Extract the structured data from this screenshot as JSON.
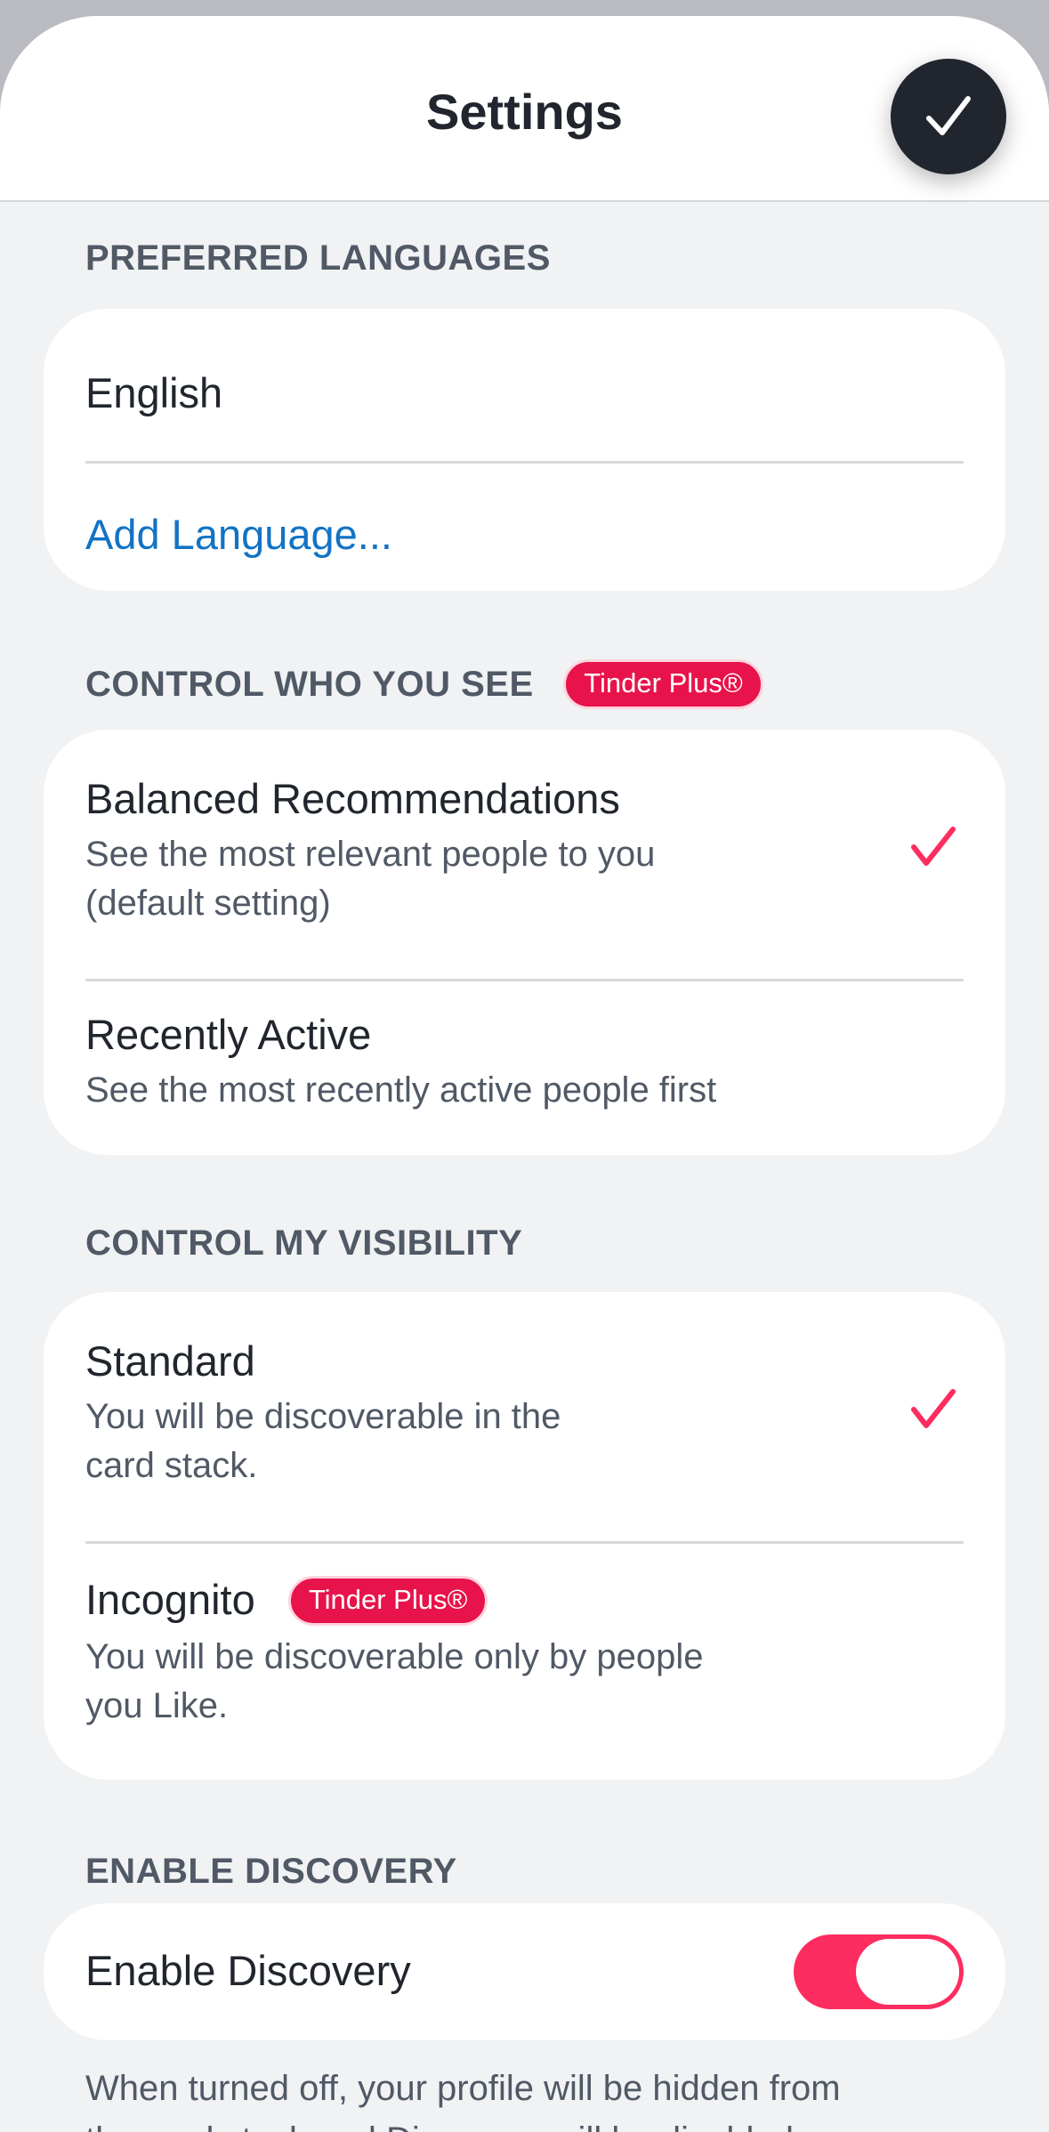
{
  "header": {
    "title": "Settings",
    "done_icon": "checkmark-icon"
  },
  "preferred_languages": {
    "label": "PREFERRED LANGUAGES",
    "languages": [
      "English"
    ],
    "add_link": "Add Language..."
  },
  "control_who_you_see": {
    "label": "CONTROL WHO YOU SEE",
    "badge": "Tinder Plus®",
    "options": [
      {
        "title": "Balanced Recommendations",
        "subtitle_lines": [
          "See the most relevant people to you",
          "(default setting)"
        ],
        "selected": true
      },
      {
        "title": "Recently Active",
        "subtitle_lines": [
          "See the most recently active people first"
        ],
        "selected": false
      }
    ]
  },
  "control_my_visibility": {
    "label": "CONTROL MY VISIBILITY",
    "options": [
      {
        "title": "Standard",
        "subtitle_lines": [
          "You will be discoverable in the",
          "card stack."
        ],
        "selected": true
      },
      {
        "title": "Incognito",
        "badge": "Tinder Plus®",
        "subtitle_lines": [
          "You will be discoverable only by people",
          "you Like."
        ],
        "selected": false
      }
    ]
  },
  "enable_discovery": {
    "label": "ENABLE DISCOVERY",
    "toggle_label": "Enable Discovery",
    "enabled": true,
    "footer_lines": [
      "When turned off, your profile will be hidden from",
      "the card stack and Discovery will be disabled."
    ]
  },
  "colors": {
    "accent": "#fd2d5f",
    "badge": "#e8134b",
    "link": "#1273c4",
    "dark": "#21262e"
  }
}
